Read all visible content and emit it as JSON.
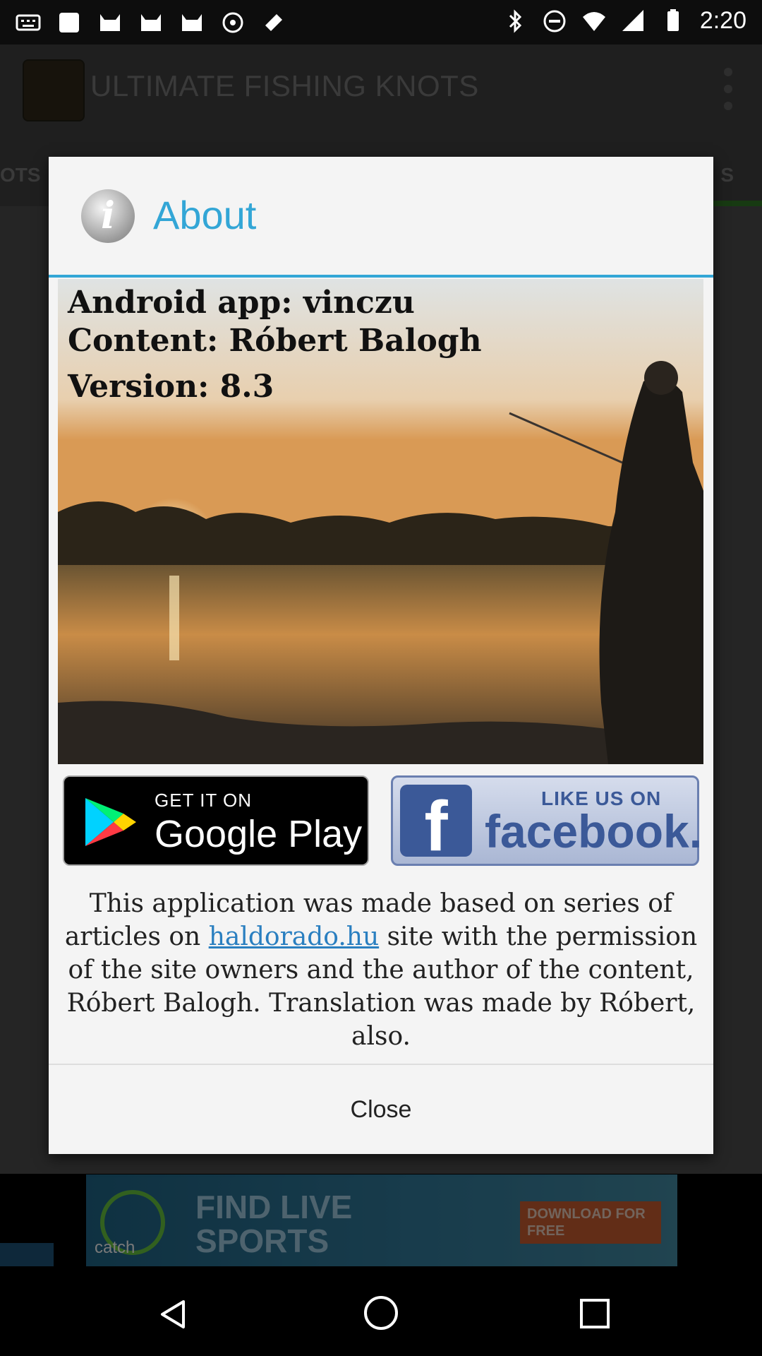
{
  "status_bar": {
    "time": "2:20"
  },
  "app": {
    "title": "ULTIMATE FISHING KNOTS",
    "tab_left_fragment": "OTS",
    "tab_right_fragment": "S"
  },
  "ad": {
    "brand": "catch",
    "headline_line1": "FIND LIVE",
    "headline_line2": "SPORTS",
    "cta": "DOWNLOAD FOR FREE"
  },
  "dialog": {
    "title": "About",
    "photo_lines": {
      "app_credit": "Android app: vinczu",
      "content_credit": "Content: Róbert Balogh",
      "version": "Version: 8.3"
    },
    "google_play": {
      "small": "GET IT ON",
      "big": "Google Play"
    },
    "facebook": {
      "small": "LIKE US ON",
      "big": "facebook."
    },
    "description": {
      "part1": "This application was made based on series of articles on ",
      "link": "haldorado.hu",
      "part2": " site with the permission of the site owners and the author of the content, Róbert Balogh. Translation was made by Róbert, also."
    },
    "close_label": "Close",
    "accent_color": "#33a6d6"
  }
}
